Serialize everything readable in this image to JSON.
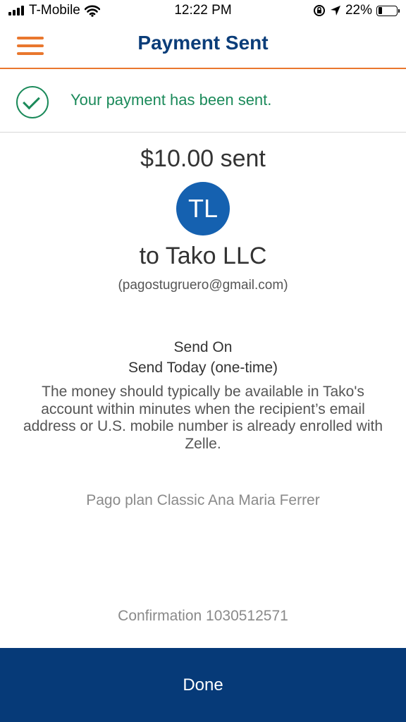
{
  "status_bar": {
    "carrier": "T-Mobile",
    "time": "12:22 PM",
    "battery": "22%",
    "battery_level": 0.22
  },
  "header": {
    "title": "Payment Sent"
  },
  "banner": {
    "message": "Your payment has been sent."
  },
  "payment": {
    "amount_text": "$10.00 sent",
    "avatar_initials": "TL",
    "recipient": "to Tako LLC",
    "email": "(pagostugruero@gmail.com)",
    "send_on_label": "Send On",
    "send_on_value": "Send Today (one-time)",
    "availability_note": "The money should typically be available in Tako's account within minutes when the recipient’s email address or U.S. mobile number is already enrolled with Zelle.",
    "memo": "Pago plan Classic Ana Maria Ferrer",
    "confirmation": "Confirmation 1030512571"
  },
  "actions": {
    "done_label": "Done"
  },
  "colors": {
    "brand_blue": "#0b3d79",
    "accent_orange": "#e9772e",
    "success_green": "#1b8a5a",
    "avatar_blue": "#1561b0",
    "button_blue": "#063a78"
  }
}
